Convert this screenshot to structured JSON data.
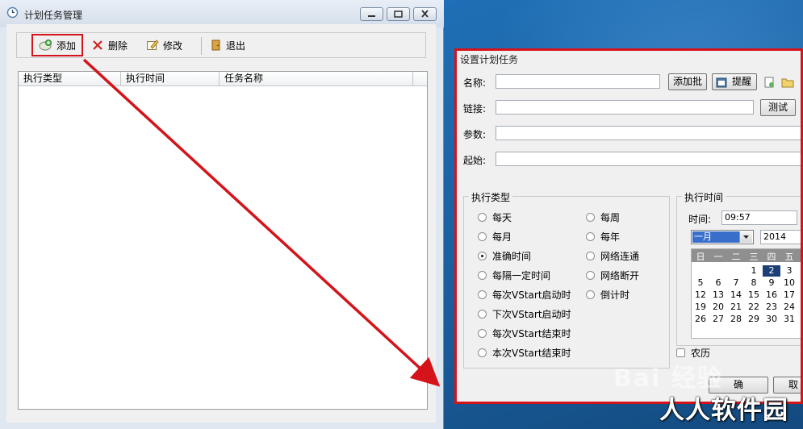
{
  "main_window": {
    "title": "计划任务管理",
    "toolbar": {
      "add": "添加",
      "delete": "删除",
      "edit": "修改",
      "exit": "退出"
    },
    "columns": [
      "执行类型",
      "执行时间",
      "任务名称"
    ]
  },
  "dialog": {
    "title": "设置计划任务",
    "name_label": "名称:",
    "name_value": "",
    "add_batch": "添加批",
    "remind": "提醒",
    "link_label": "链接:",
    "link_value": "",
    "test": "测试",
    "param_label": "参数:",
    "param_value": "",
    "start_label": "起始:",
    "start_value": "",
    "exec_type": {
      "title": "执行类型",
      "options_left": [
        "每天",
        "每月",
        "准确时间",
        "每隔一定时间",
        "每次VStart启动时",
        "下次VStart启动时",
        "每次VStart结束时",
        "本次VStart结束时"
      ],
      "options_right": [
        "每周",
        "每年",
        "网络连通",
        "网络断开",
        "倒计时"
      ],
      "selected": "准确时间"
    },
    "exec_time": {
      "title": "执行时间",
      "time_label": "时间:",
      "time_value": "09:57",
      "month": "一月",
      "year": "2014",
      "weekdays": [
        "日",
        "一",
        "二",
        "三",
        "四",
        "五"
      ],
      "selected_day": "2",
      "lunar": "农历"
    },
    "ok": "确",
    "cancel": "取"
  },
  "watermark": {
    "text": "人人软件园",
    "baidu": "Bai 经验"
  },
  "colors": {
    "highlight_red": "#d4131a",
    "selection_blue": "#1d3f75"
  }
}
